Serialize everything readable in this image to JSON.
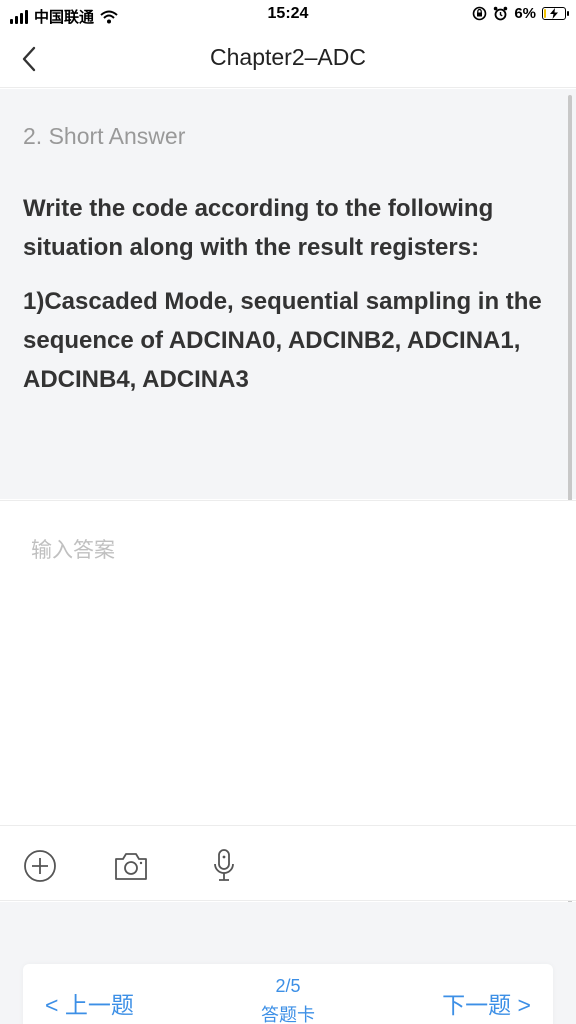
{
  "status_bar": {
    "carrier": "中国联通",
    "time": "15:24",
    "battery_percent": "6%",
    "battery_level": 0.06,
    "icons": [
      "signal-icon",
      "wifi-icon",
      "lock-rotation-icon",
      "alarm-icon",
      "battery-charging-icon"
    ]
  },
  "nav": {
    "back_icon": "chevron-left-icon",
    "title": "Chapter2–ADC"
  },
  "question": {
    "type_label": "2. Short Answer",
    "paragraphs": [
      "Write the code according to the following situation along with the result registers:",
      "1)Cascaded Mode, sequential sampling in the sequence of ADCINA0, ADCINB2, ADCINA1, ADCINB4, ADCINA3"
    ]
  },
  "answer": {
    "placeholder": "输入答案",
    "value": ""
  },
  "toolbar": {
    "icons": [
      "add-icon",
      "camera-icon",
      "microphone-icon"
    ]
  },
  "footer": {
    "prev_label": "< 上一题",
    "next_label": "下一题 >",
    "page": "2/5",
    "card_label": "答题卡"
  },
  "colors": {
    "accent": "#3c8fe6",
    "question_bg": "#f4f5f7",
    "battery": "#f2c200"
  }
}
